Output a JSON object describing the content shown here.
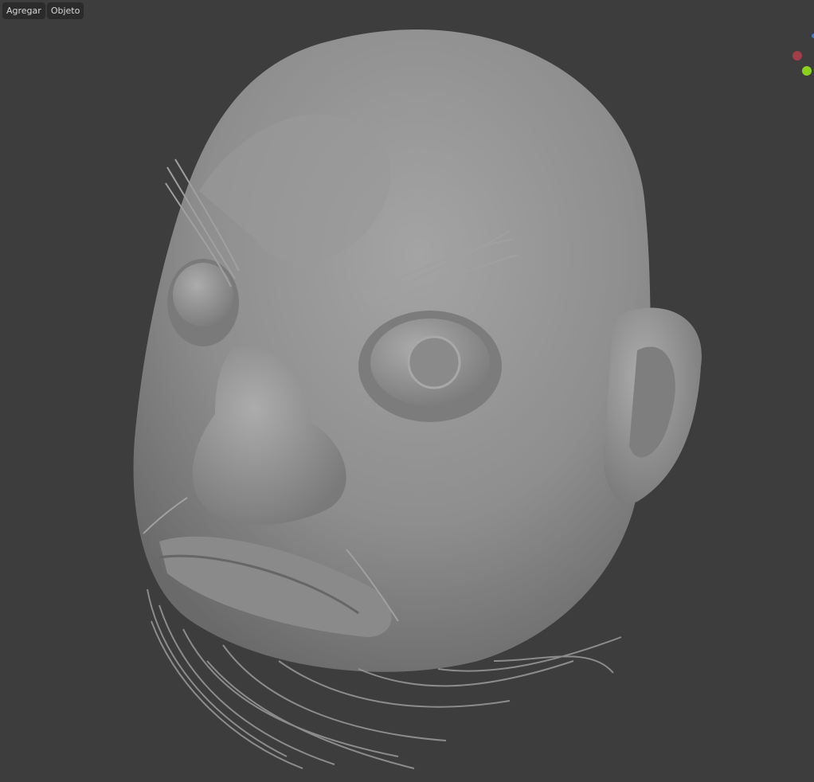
{
  "header_menu": [
    {
      "label": "Agregar"
    },
    {
      "label": "Objeto"
    }
  ],
  "gizmo": {
    "x_axis_color": "#a23d4a",
    "y_axis_color": "#8ad11c",
    "z_axis_color": "#3a7bd5"
  },
  "viewport": {
    "background": "#3d3d3d",
    "object": "sculpted-head"
  }
}
